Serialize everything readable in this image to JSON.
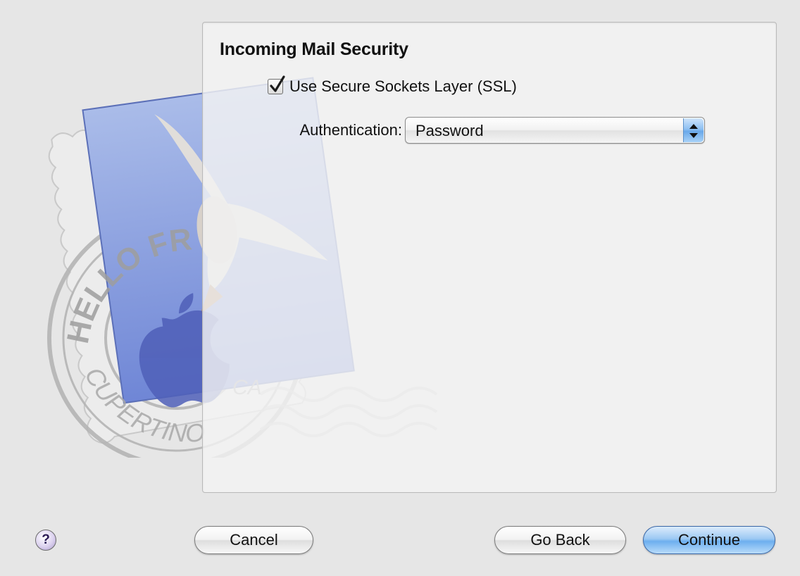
{
  "panel": {
    "title": "Incoming Mail Security",
    "ssl_checkbox": {
      "label": "Use Secure Sockets Layer (SSL)",
      "checked": true
    },
    "authentication": {
      "label": "Authentication:",
      "value": "Password"
    }
  },
  "artwork": {
    "stamp_text_top": "HELLO FR",
    "stamp_text_bottom": "CUPERTINO",
    "stamp_state": "CA"
  },
  "footer": {
    "help_label": "?",
    "cancel_label": "Cancel",
    "go_back_label": "Go Back",
    "continue_label": "Continue"
  },
  "colors": {
    "window_bg": "#e6e6e6",
    "default_button": "#6dafef",
    "popup_arrows": "#6aa9ea"
  }
}
